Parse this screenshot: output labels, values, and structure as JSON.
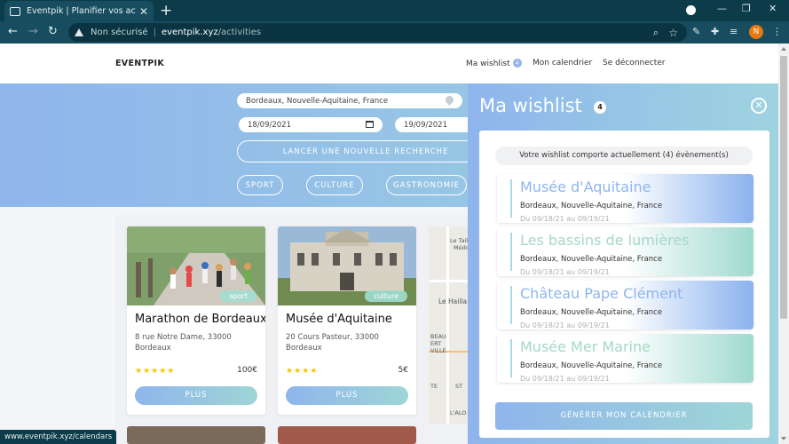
{
  "browser": {
    "tab_title": "Eventpik | Planifier vos activités",
    "tab_close": "✕",
    "new_tab": "+",
    "security_label": "Non sécurisé",
    "separator": "|",
    "url_host": "eventpik.xyz",
    "url_path": "/activities",
    "profile_initial": "N",
    "status_url": "www.eventpik.xyz/calendars",
    "icons": [
      "back-icon",
      "forward-icon",
      "reload-icon",
      "warning-icon",
      "zoom-icon",
      "star-icon",
      "pen-icon",
      "puzzle-icon",
      "media-icon",
      "more-icon"
    ]
  },
  "site": {
    "brand": "EVENTPIK",
    "nav": {
      "wishlist": "Ma wishlist",
      "wishlist_count": "4",
      "calendar": "Mon calendrier",
      "logout": "Se déconnecter"
    },
    "search": {
      "location": "Bordeaux, Nouvelle-Aquitaine, France",
      "date_from": "18/09/2021",
      "date_to": "19/09/2021",
      "launch_button": "LANCER UNE NOUVELLE RECHERCHE",
      "categories": [
        "SPORT",
        "CULTURE",
        "GASTRONOMIE"
      ]
    },
    "cards": [
      {
        "title": "Marathon de Bordeaux",
        "category": "sport",
        "address": "8 rue Notre Dame, 33000",
        "city": "Bordeaux",
        "rating_stars": "★★★★★",
        "rating": 5,
        "price": "100€",
        "button": "PLUS"
      },
      {
        "title": "Musée d'Aquitaine",
        "category": "culture",
        "address": "20 Cours Pasteur, 33000",
        "city": "Bordeaux",
        "rating_stars": "★★★★",
        "rating": 4,
        "price": "5€",
        "button": "PLUS"
      }
    ],
    "map_labels": [
      "Le Taill",
      "Médo",
      "Le Hailla",
      "BEAU",
      "ERT",
      "VILLE",
      "TE",
      "ST",
      "L'ALO"
    ]
  },
  "wishlist": {
    "title": "Ma wishlist",
    "count": "4",
    "close": "✕",
    "summary": "Votre wishlist comporte actuellement (4) évènement(s)",
    "items": [
      {
        "name": "Musée d'Aquitaine",
        "location": "Bordeaux, Nouvelle-Aquitaine, France",
        "dates": "Du 09/18/21 au 09/19/21",
        "style": "blue"
      },
      {
        "name": "Les bassins de lumières",
        "location": "Bordeaux, Nouvelle-Aquitaine, France",
        "dates": "Du 09/18/21 au 09/19/21",
        "style": "green"
      },
      {
        "name": "Château Pape Clément",
        "location": "Bordeaux, Nouvelle-Aquitaine, France",
        "dates": "Du 09/18/21 au 09/19/21",
        "style": "blue"
      },
      {
        "name": "Musée Mer Marine",
        "location": "Bordeaux, Nouvelle-Aquitaine, France",
        "dates": "Du 09/18/21 au 09/19/21",
        "style": "green"
      }
    ],
    "generate_button": "GÉNÉRER MON CALENDRIER"
  },
  "colors": {
    "chrome_dark": "#0c3b49",
    "chrome": "#174d5e",
    "accent_blue": "#8fb5ec",
    "accent_green": "#a0d9ce",
    "star": "#f3c400"
  }
}
